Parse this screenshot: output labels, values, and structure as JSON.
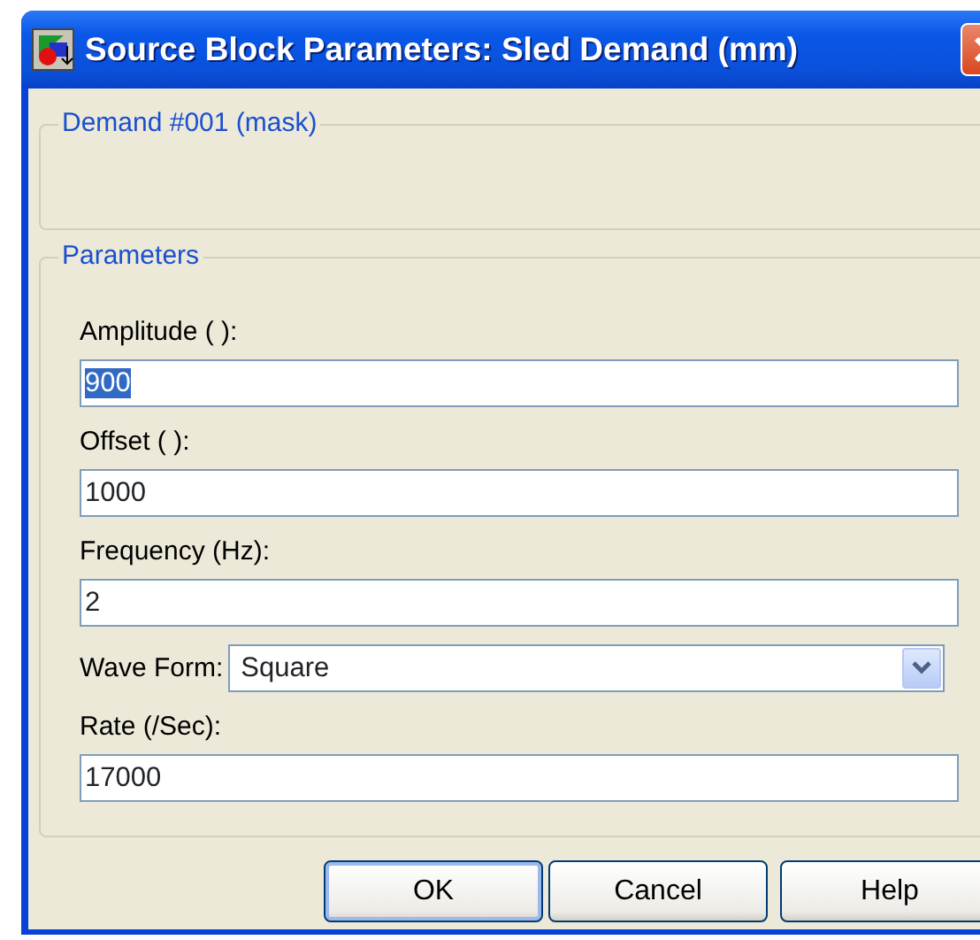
{
  "window": {
    "title": "Source Block Parameters: Sled Demand (mm)"
  },
  "mask_group": {
    "title": "Demand #001 (mask)"
  },
  "parameters": {
    "title": "Parameters",
    "fields": [
      {
        "kind": "text",
        "label": "Amplitude ( ):",
        "value": "900",
        "text_selected": true
      },
      {
        "kind": "text",
        "label": "Offset ( ):",
        "value": "1000",
        "text_selected": false
      },
      {
        "kind": "text",
        "label": "Frequency (Hz):",
        "value": "2",
        "text_selected": false
      },
      {
        "kind": "dropdown",
        "label": "Wave Form:",
        "value": "Square"
      },
      {
        "kind": "text",
        "label": "Rate (/Sec):",
        "value": "17000",
        "text_selected": false
      }
    ]
  },
  "buttons": [
    {
      "label": "OK",
      "default": true
    },
    {
      "label": "Cancel",
      "default": false
    },
    {
      "label": "Help",
      "default": false
    }
  ]
}
